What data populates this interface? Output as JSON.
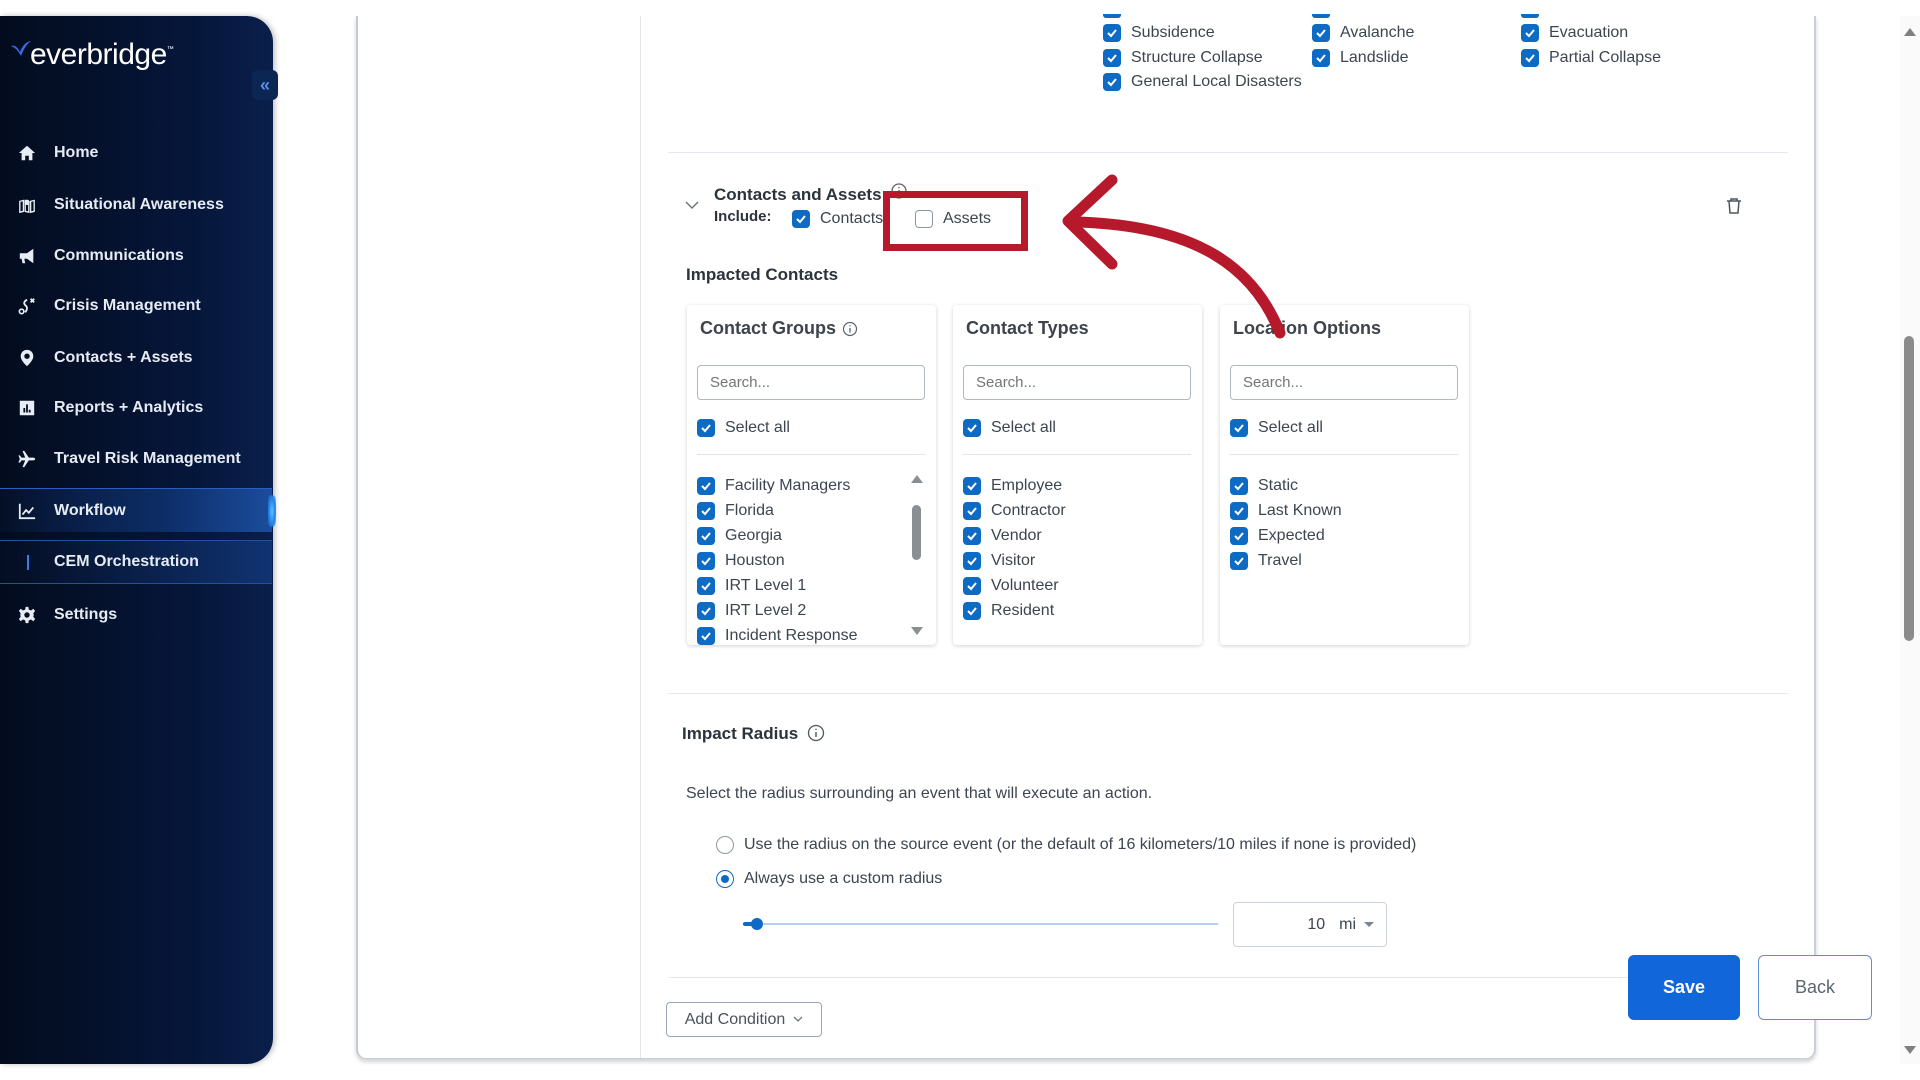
{
  "sidebar": {
    "logo_text": "everbridge",
    "logo_tm": "™",
    "collapse_label": "«",
    "items": [
      {
        "label": "Home",
        "icon": "home-icon"
      },
      {
        "label": "Situational Awareness",
        "icon": "map-pin-icon"
      },
      {
        "label": "Communications",
        "icon": "megaphone-icon"
      },
      {
        "label": "Crisis Management",
        "icon": "route-icon"
      },
      {
        "label": "Contacts + Assets",
        "icon": "location-pin-icon"
      },
      {
        "label": "Reports + Analytics",
        "icon": "bar-chart-icon"
      },
      {
        "label": "Travel Risk Management",
        "icon": "airplane-icon"
      },
      {
        "label": "Workflow",
        "icon": "line-chart-icon",
        "active": true
      },
      {
        "label": "CEM Orchestration",
        "sub": true
      },
      {
        "label": "Settings",
        "icon": "gear-icon"
      }
    ]
  },
  "event_types": {
    "items": [
      {
        "label": "Subsidence",
        "checked": true
      },
      {
        "label": "Structure Collapse",
        "checked": true
      },
      {
        "label": "General Local Disasters",
        "checked": true
      },
      {
        "label": "Avalanche",
        "checked": true
      },
      {
        "label": "Landslide",
        "checked": true
      },
      {
        "label": "Evacuation",
        "checked": true
      },
      {
        "label": "Partial Collapse",
        "checked": true
      }
    ]
  },
  "contacts_assets": {
    "title": "Contacts and Assets",
    "include_label": "Include:",
    "contacts": {
      "label": "Contacts",
      "checked": true
    },
    "assets": {
      "label": "Assets",
      "checked": false
    }
  },
  "impacted_contacts": {
    "title": "Impacted Contacts",
    "panels": [
      {
        "title": "Contact Groups",
        "has_info": true,
        "search_placeholder": "Search...",
        "select_all": "Select all",
        "items": [
          "Facility Managers",
          "Florida",
          "Georgia",
          "Houston",
          "IRT Level 1",
          "IRT Level 2",
          "Incident Response"
        ]
      },
      {
        "title": "Contact Types",
        "search_placeholder": "Search...",
        "select_all": "Select all",
        "items": [
          "Employee",
          "Contractor",
          "Vendor",
          "Visitor",
          "Volunteer",
          "Resident"
        ]
      },
      {
        "title": "Location Options",
        "search_placeholder": "Search...",
        "select_all": "Select all",
        "items": [
          "Static",
          "Last Known",
          "Expected",
          "Travel"
        ]
      }
    ]
  },
  "impact_radius": {
    "title": "Impact Radius",
    "description": "Select the radius surrounding an event that will execute an action.",
    "option_source": "Use the radius on the source event (or the default of 16 kilometers/10 miles if none is provided)",
    "option_custom": "Always use a custom radius",
    "selected_option": "custom",
    "value": "10",
    "unit": "mi",
    "slider_fraction": 0.03
  },
  "buttons": {
    "add_condition": "Add Condition",
    "save": "Save",
    "back": "Back"
  },
  "colors": {
    "accent": "#0d6bc4",
    "primary_button": "#1166d9",
    "annotation_red": "#b5192b",
    "sidebar_bg": "#06163a"
  }
}
